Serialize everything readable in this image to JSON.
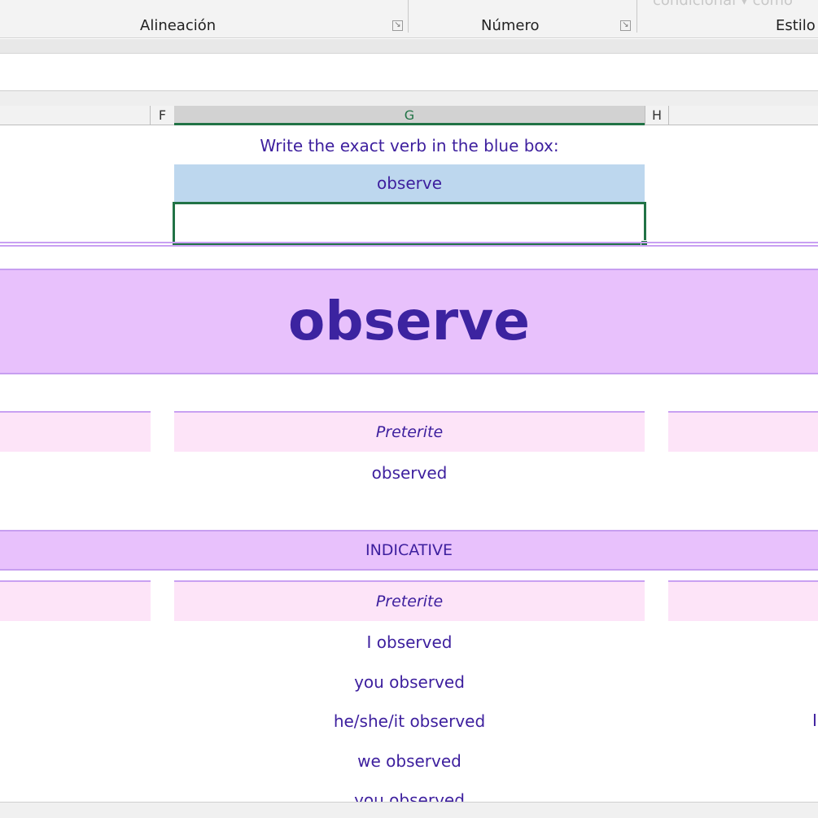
{
  "ribbon": {
    "groups": [
      {
        "label": "Alineación"
      },
      {
        "label": "Número"
      },
      {
        "label": "Estilo"
      }
    ],
    "faded_text": "condicional ▾  como"
  },
  "columns": {
    "f": "F",
    "g": "G",
    "h": "H"
  },
  "sheet": {
    "instruction": "Write the exact verb in the blue box:",
    "verb_cell": "observe",
    "answer_cell": "",
    "title": "observe",
    "preterite_header_1": "Preterite",
    "preterite_value": "observed",
    "indicative_band": "INDICATIVE",
    "preterite_header_2": "Preterite",
    "conjugations": [
      "I observed",
      "you observed",
      "he/she/it observed",
      "we observed",
      "you observed"
    ],
    "right_fragment": "I"
  },
  "colors": {
    "text_purple": "#3d1f9e",
    "blue_box": "#bdd7ee",
    "lavender_band": "#e8c1fc",
    "pink_header": "#fde4f8",
    "excel_green": "#217346"
  }
}
